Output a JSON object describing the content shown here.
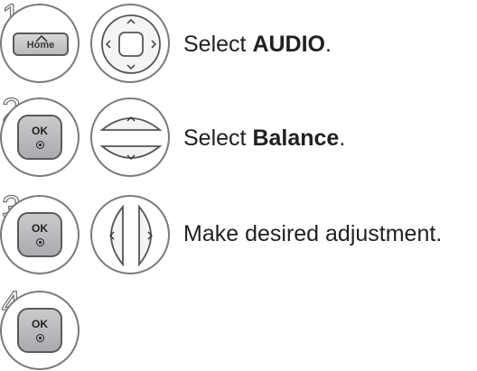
{
  "steps": [
    {
      "number": "1",
      "keys": [
        "Home",
        "nav-4way"
      ],
      "text_prefix": "Select ",
      "text_bold": "AUDIO",
      "text_suffix": "."
    },
    {
      "number": "2",
      "keys": [
        "OK",
        "nav-updown"
      ],
      "text_prefix": "Select ",
      "text_bold": "Balance",
      "text_suffix": "."
    },
    {
      "number": "3",
      "keys": [
        "OK",
        "nav-leftright"
      ],
      "text_prefix": "Make desired adjustment.",
      "text_bold": "",
      "text_suffix": ""
    },
    {
      "number": "4",
      "keys": [
        "OK"
      ],
      "text_prefix": "",
      "text_bold": "",
      "text_suffix": ""
    }
  ],
  "key_labels": {
    "home": "Home",
    "ok": "OK"
  }
}
